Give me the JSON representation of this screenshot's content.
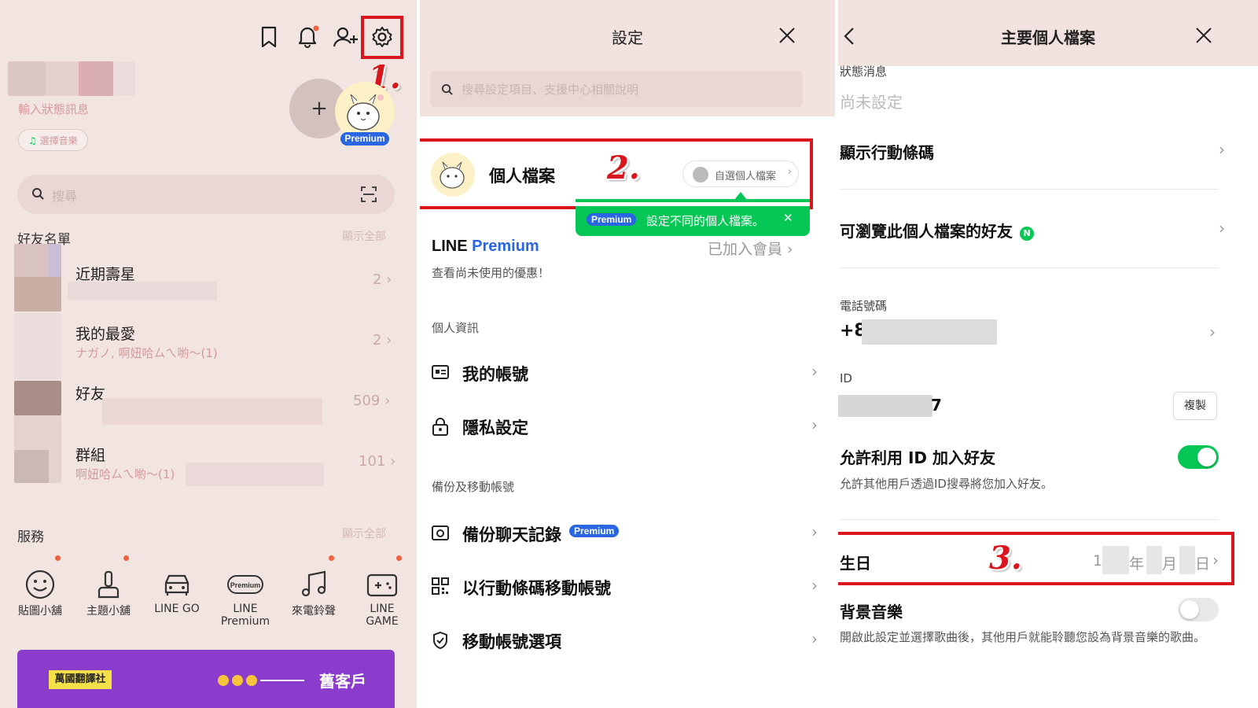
{
  "panel1": {
    "status_placeholder": "輸入狀態訊息",
    "music_button": "選擇音樂",
    "premium_badge": "Premium",
    "add_symbol": "+",
    "search_placeholder": "搜尋",
    "friends_section": "好友名單",
    "show_all": "顯示全部",
    "groups": [
      {
        "title": "近期壽星",
        "sub": "",
        "count": "2"
      },
      {
        "title": "我的最愛",
        "sub": "ナガノ, 啊妞哈ㄙㄟ喲～(1)",
        "count": "2"
      },
      {
        "title": "好友",
        "sub": "",
        "count": "509"
      },
      {
        "title": "群組",
        "sub": "啊妞哈ㄙㄟ喲～(1)",
        "count": "101"
      }
    ],
    "services_section": "服務",
    "services_show_all": "顯示全部",
    "services": [
      {
        "label": "貼圖小舖",
        "icon": "smiley-icon"
      },
      {
        "label": "主題小舖",
        "icon": "brush-icon"
      },
      {
        "label": "LINE GO",
        "icon": "car-icon"
      },
      {
        "label": "LINE Premium",
        "icon": "premium-icon"
      },
      {
        "label": "來電鈴聲",
        "icon": "music-note-icon"
      },
      {
        "label": "LINE GAME",
        "icon": "gamepad-icon"
      }
    ],
    "banner_tag": "萬國翻譯社",
    "banner_text": "舊客戶",
    "marker": "1."
  },
  "panel2": {
    "title": "設定",
    "search_placeholder": "搜尋設定項目、支援中心相關說明",
    "profile_label": "個人檔案",
    "custom_profile_button": "自選個人檔案",
    "tooltip_badge": "Premium",
    "tooltip_text": "設定不同的個人檔案。",
    "line_premium_line": "LINE",
    "line_premium_word": "Premium",
    "premium_status": "已加入會員",
    "premium_sub": "查看尚未使用的優惠！",
    "section_personal": "個人資訊",
    "my_account": "我的帳號",
    "privacy": "隱私設定",
    "section_backup": "備份及移動帳號",
    "backup_chat": "備份聊天記錄",
    "backup_badge": "Premium",
    "move_qr": "以行動條碼移動帳號",
    "move_options": "移動帳號選項",
    "marker": "2."
  },
  "panel3": {
    "title": "主要個人檔案",
    "status_label": "狀態消息",
    "status_value": "尚未設定",
    "show_qr": "顯示行動條碼",
    "friends_view": "可瀏覽此個人檔案的好友",
    "friends_view_badge": "N",
    "phone_label": "電話號碼",
    "phone_value": "+8",
    "id_label": "ID",
    "id_value": "7",
    "copy_button": "複製",
    "allow_id": "允許利用 ID 加入好友",
    "allow_id_desc": "允許其他用戶透過ID搜尋將您加入好友。",
    "allow_id_on": true,
    "birthday_label": "生日",
    "birthday_prefix": "1",
    "birthday_year": "年",
    "birthday_month": "月",
    "birthday_day": "日",
    "bg_music": "背景音樂",
    "bg_music_desc": "開啟此設定並選擇歌曲後，其他用戶就能聆聽您設為背景音樂的歌曲。",
    "bg_music_on": false,
    "marker": "3."
  },
  "colors": {
    "accent_red": "#d9161d",
    "line_green": "#06c755",
    "premium_blue": "#3e6be5",
    "panel1_bg": "#f2e4e1"
  }
}
